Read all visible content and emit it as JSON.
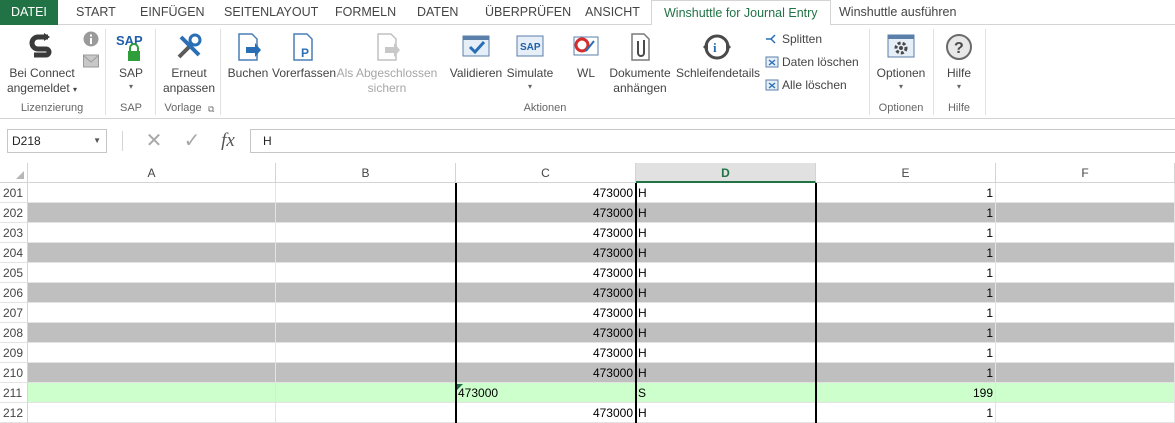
{
  "tabs": {
    "datei": "DATEI",
    "start": "START",
    "einfuegen": "EINFÜGEN",
    "seitenlayout": "SEITENLAYOUT",
    "formeln": "FORMELN",
    "daten": "DATEN",
    "ueberpruefen": "ÜBERPRÜFEN",
    "ansicht": "ANSICHT",
    "winshuttle_je": "Winshuttle for Journal Entry",
    "winshuttle_run": "Winshuttle ausführen"
  },
  "ribbon": {
    "bei_connect_1": "Bei Connect",
    "bei_connect_2": "angemeldet",
    "sap": "SAP",
    "erneut_1": "Erneut",
    "erneut_2": "anpassen",
    "buchen": "Buchen",
    "vorerfassen": "Vorerfassen",
    "abgeschlossen_1": "Als Abgeschlossen",
    "abgeschlossen_2": "sichern",
    "validieren": "Validieren",
    "simulate": "Simulate",
    "wl": "WL",
    "dokumente_1": "Dokumente",
    "dokumente_2": "anhängen",
    "schleifendetails": "Schleifendetails",
    "splitten": "Splitten",
    "daten_loeschen": "Daten löschen",
    "alle_loeschen": "Alle löschen",
    "optionen": "Optionen",
    "hilfe": "Hilfe",
    "groups": {
      "lizenzierung": "Lizenzierung",
      "sap": "SAP",
      "vorlage": "Vorlage",
      "aktionen": "Aktionen",
      "optionen": "Optionen",
      "hilfe": "Hilfe"
    }
  },
  "formula_bar": {
    "name_box": "D218",
    "formula": "H"
  },
  "columns": [
    "A",
    "B",
    "C",
    "D",
    "E",
    "F"
  ],
  "selected_column": "D",
  "rows": [
    {
      "num": "201",
      "c": "473000",
      "d": "H",
      "e": "1",
      "style": "white"
    },
    {
      "num": "202",
      "c": "473000",
      "d": "H",
      "e": "1",
      "style": "gray"
    },
    {
      "num": "203",
      "c": "473000",
      "d": "H",
      "e": "1",
      "style": "white"
    },
    {
      "num": "204",
      "c": "473000",
      "d": "H",
      "e": "1",
      "style": "gray"
    },
    {
      "num": "205",
      "c": "473000",
      "d": "H",
      "e": "1",
      "style": "white"
    },
    {
      "num": "206",
      "c": "473000",
      "d": "H",
      "e": "1",
      "style": "gray"
    },
    {
      "num": "207",
      "c": "473000",
      "d": "H",
      "e": "1",
      "style": "white"
    },
    {
      "num": "208",
      "c": "473000",
      "d": "H",
      "e": "1",
      "style": "gray"
    },
    {
      "num": "209",
      "c": "473000",
      "d": "H",
      "e": "1",
      "style": "white"
    },
    {
      "num": "210",
      "c": "473000",
      "d": "H",
      "e": "1",
      "style": "gray"
    },
    {
      "num": "211",
      "c": "473000",
      "d": "S",
      "e": "199",
      "style": "green",
      "c_text": true
    },
    {
      "num": "212",
      "c": "473000",
      "d": "H",
      "e": "1",
      "style": "white"
    }
  ],
  "colors": {
    "excel_green": "#217346",
    "row_gray": "#bfbfbf",
    "row_green": "#ccffcc"
  }
}
